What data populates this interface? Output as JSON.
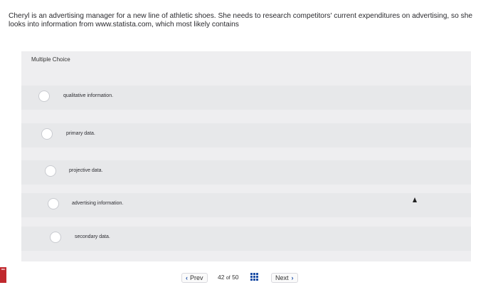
{
  "question": {
    "text": "Cheryl is an advertising manager for a new line of athletic shoes. She needs to research competitors' current expenditures on advertising, so she looks into information from www.statista.com, which most likely contains"
  },
  "multiple_choice": {
    "header": "Multiple Choice",
    "options": [
      {
        "label": "qualitative information."
      },
      {
        "label": "primary data."
      },
      {
        "label": "projective data."
      },
      {
        "label": "advertising information."
      },
      {
        "label": "secondary data."
      }
    ]
  },
  "footer": {
    "prev_label": "Prev",
    "current_page": "42",
    "of_label": "of",
    "total_pages": "50",
    "next_label": "Next",
    "prev_icon": "chevron-left-icon",
    "next_icon": "chevron-right-icon",
    "grid_icon": "grid-icon",
    "accent_color": "#1d4fa6"
  },
  "logo": {
    "text": "mc"
  }
}
